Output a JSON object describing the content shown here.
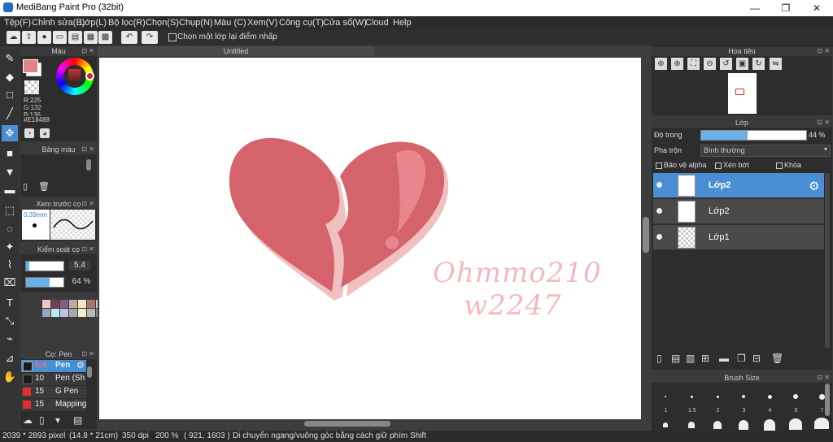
{
  "window": {
    "title": "MediBang Paint Pro (32bit)",
    "minimize": "—",
    "maximize": "❐",
    "close": "✕"
  },
  "menu": [
    "Tệp(F)",
    "Chỉnh sửa(E)",
    "Lớp(L)",
    "Bộ lọc(R)",
    "Chọn(S)",
    "Chụp(N)",
    "Màu (C)",
    "Xem(V)",
    "Công cụ(T)",
    "Cửa sổ(W)",
    "Cloud",
    "Help"
  ],
  "toolbar": {
    "select_layer_label": "Chọn một lớp lại điểm nhấp"
  },
  "document": {
    "tab_title": "Untitled"
  },
  "color_panel": {
    "title": "Màu",
    "r": "R:225",
    "g": "G:132",
    "b": "B:136",
    "hex": "#E18488",
    "primary": "#E18488"
  },
  "palette_panel": {
    "title": "Bảng màu",
    "colors": [
      "#e8c8c0",
      "#704050",
      "#806080",
      "#c0a8a0",
      "#f0e8c0",
      "#a87870",
      "#c8d8a0",
      "#688060",
      "#a0a0c0",
      "#c0e8f0",
      "#c0c0e8",
      "#a8a8a8",
      "#f0f0d0",
      "#b8b8b8",
      "#888898",
      "#d8d8d8"
    ]
  },
  "brush_preview": {
    "title": "Xem trước cọ",
    "size": "0.39mm"
  },
  "brush_control": {
    "title": "Kiểm soát cọ",
    "size_value": "5.4",
    "opacity_value": "64 %"
  },
  "brush_list": {
    "title": "Cọ: Pen",
    "items": [
      {
        "size": "5.4",
        "name": "Pen",
        "color": "#1a1a1a"
      },
      {
        "size": "10",
        "name": "Pen (Sh",
        "color": "#1a1a1a"
      },
      {
        "size": "15",
        "name": "G Pen",
        "color": "#e03030"
      },
      {
        "size": "15",
        "name": "Mapping",
        "color": "#e03030"
      }
    ]
  },
  "navigator": {
    "title": "Hoa tiêu"
  },
  "layers": {
    "title": "Lớp",
    "opacity_label": "Độ trong",
    "opacity_value": "44 %",
    "opacity_fraction": 0.44,
    "blend_label": "Pha trộn",
    "blend_value": "Bình thường",
    "protect_alpha": "Bảo vệ alpha",
    "clipping": "Xén bớt",
    "lock": "Khóa",
    "items": [
      {
        "name": "Lớp2"
      },
      {
        "name": "Lớp2"
      },
      {
        "name": "Lớp1"
      }
    ]
  },
  "brush_size_panel": {
    "title": "Brush Size",
    "sizes": [
      "1",
      "1.5",
      "2",
      "3",
      "4",
      "5",
      "7"
    ]
  },
  "canvas_text": {
    "line1": "Ohmmo210",
    "line2": "w2247"
  },
  "status": {
    "dimensions": "2039 * 2893 pixel",
    "physical": "(14.8 * 21cm)",
    "dpi": "350 dpi",
    "zoom": "200 %",
    "coords": "( 921, 1603 )",
    "hint": "Di chuyển ngang/vuông góc bằng cách giữ phím Shift"
  }
}
